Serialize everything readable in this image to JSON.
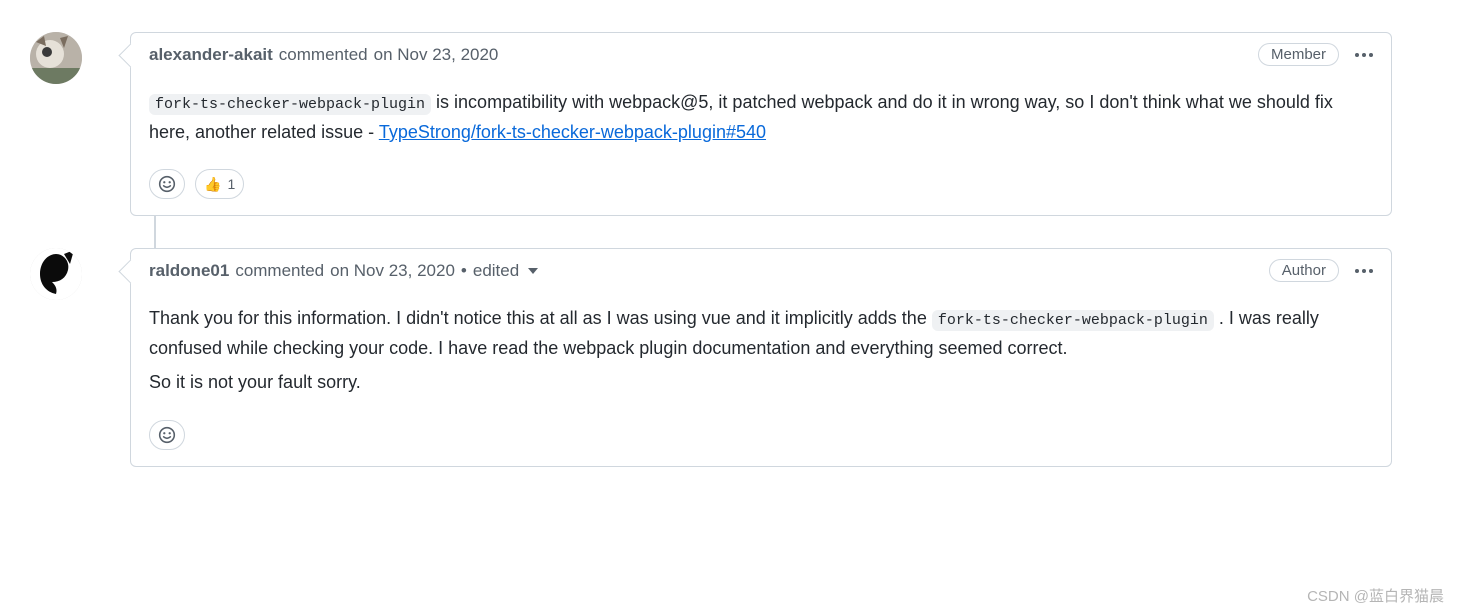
{
  "comments": [
    {
      "author": "alexander-akait",
      "commented_label": "commented",
      "date_label": "on Nov 23, 2020",
      "badge": "Member",
      "edited": false,
      "edited_label": "",
      "body_code_1": "fork-ts-checker-webpack-plugin",
      "body_text_1": " is incompatibility with webpack@5, it patched webpack and do it in wrong way, so I don't think what we should fix here, another related issue - ",
      "body_link_text": "TypeStrong/fork-ts-checker-webpack-plugin#540",
      "reactions": {
        "thumbs_up_emoji": "👍",
        "thumbs_up_count": "1"
      }
    },
    {
      "author": "raldone01",
      "commented_label": "commented",
      "date_label": "on Nov 23, 2020",
      "badge": "Author",
      "edited": true,
      "edited_label": "edited",
      "body_p1_a": "Thank you for this information. I didn't notice this at all as I was using vue and it implicitly adds the ",
      "body_p1_code": "fork-ts-checker-webpack-plugin",
      "body_p1_b": " . I was really confused while checking your code. I have read the webpack plugin documentation and everything seemed correct.",
      "body_p2": "So it is not your fault sorry."
    }
  ],
  "watermark": "CSDN @蓝白界猫晨"
}
